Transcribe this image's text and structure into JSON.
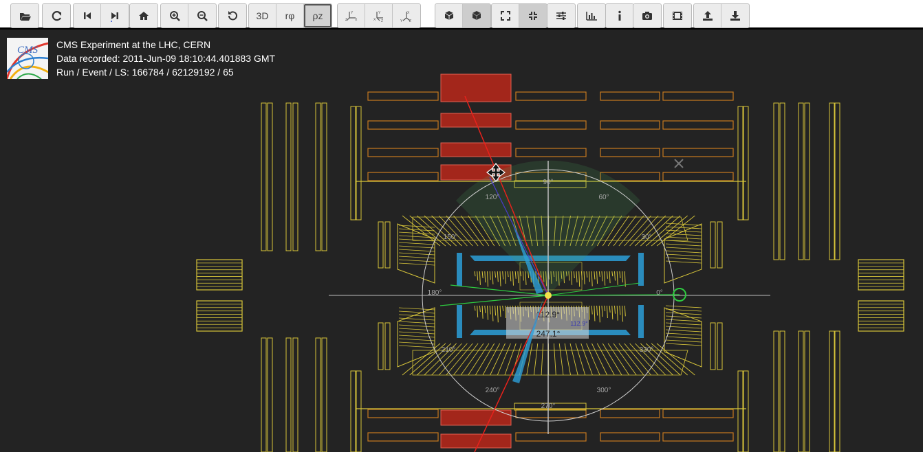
{
  "toolbar": {
    "groups": [
      [
        {
          "name": "open-file-button",
          "icon": "folder-open-icon"
        }
      ],
      [
        {
          "name": "reload-button",
          "icon": "refresh-icon"
        }
      ],
      [
        {
          "name": "previous-event-button",
          "icon": "step-backward-icon"
        },
        {
          "name": "next-event-button",
          "icon": "step-forward-icon"
        }
      ],
      [
        {
          "name": "home-view-button",
          "icon": "home-icon"
        }
      ],
      [
        {
          "name": "zoom-in-button",
          "icon": "zoom-in-icon"
        },
        {
          "name": "zoom-out-button",
          "icon": "zoom-out-icon"
        }
      ],
      [
        {
          "name": "reset-view-button",
          "icon": "undo-icon"
        }
      ],
      [
        {
          "name": "view-3d-button",
          "label": "3D"
        },
        {
          "name": "view-rphi-button",
          "label": "rφ"
        },
        {
          "name": "view-rz-button",
          "label": "ρz",
          "active": true
        }
      ],
      [
        {
          "name": "axis-yz-button",
          "icon": "axis-yz-icon"
        },
        {
          "name": "axis-xz-button",
          "icon": "axis-xz-icon"
        },
        {
          "name": "axis-xy-button",
          "icon": "axis-xy-icon"
        }
      ],
      [
        {
          "name": "perspective-camera-button",
          "icon": "cube-outline-icon"
        },
        {
          "name": "orthographic-camera-button",
          "icon": "cube-solid-icon",
          "active": true
        }
      ],
      [
        {
          "name": "enter-fullscreen-button",
          "icon": "expand-icon"
        },
        {
          "name": "exit-fullscreen-button",
          "icon": "compress-icon",
          "active": true
        }
      ],
      [
        {
          "name": "settings-button",
          "icon": "sliders-icon"
        }
      ],
      [
        {
          "name": "statistics-button",
          "icon": "bar-chart-icon"
        }
      ],
      [
        {
          "name": "info-button",
          "icon": "info-icon"
        }
      ],
      [
        {
          "name": "screenshot-button",
          "icon": "camera-icon"
        }
      ],
      [
        {
          "name": "animation-button",
          "icon": "film-icon"
        }
      ],
      [
        {
          "name": "export-button",
          "icon": "upload-icon"
        },
        {
          "name": "import-button",
          "icon": "download-icon"
        }
      ]
    ]
  },
  "event_info": {
    "logo_text": "CMS",
    "line1": "CMS Experiment at the LHC, CERN",
    "line2": "Data recorded: 2011-Jun-09 18:10:44.401883 GMT",
    "line3": "Run / Event / LS: 166784 / 62129192 / 65"
  },
  "angle_labels": [
    "90°",
    "60°",
    "120°",
    "150°",
    "30°",
    "180°",
    "0°",
    "210°",
    "330°",
    "240°",
    "300°",
    "270°"
  ],
  "measure": {
    "angle1": "112.9°",
    "angle2": "247.1°",
    "angle_small": "112.9°"
  },
  "colors": {
    "detector_yellow": "#d8c63a",
    "muon_orange": "#c87a1f",
    "muon_red_hit": "#a3261b",
    "tracker_blue": "#2c9fd8",
    "track_red": "#e8221c",
    "track_green": "#2ecc40",
    "background": "#232323"
  }
}
